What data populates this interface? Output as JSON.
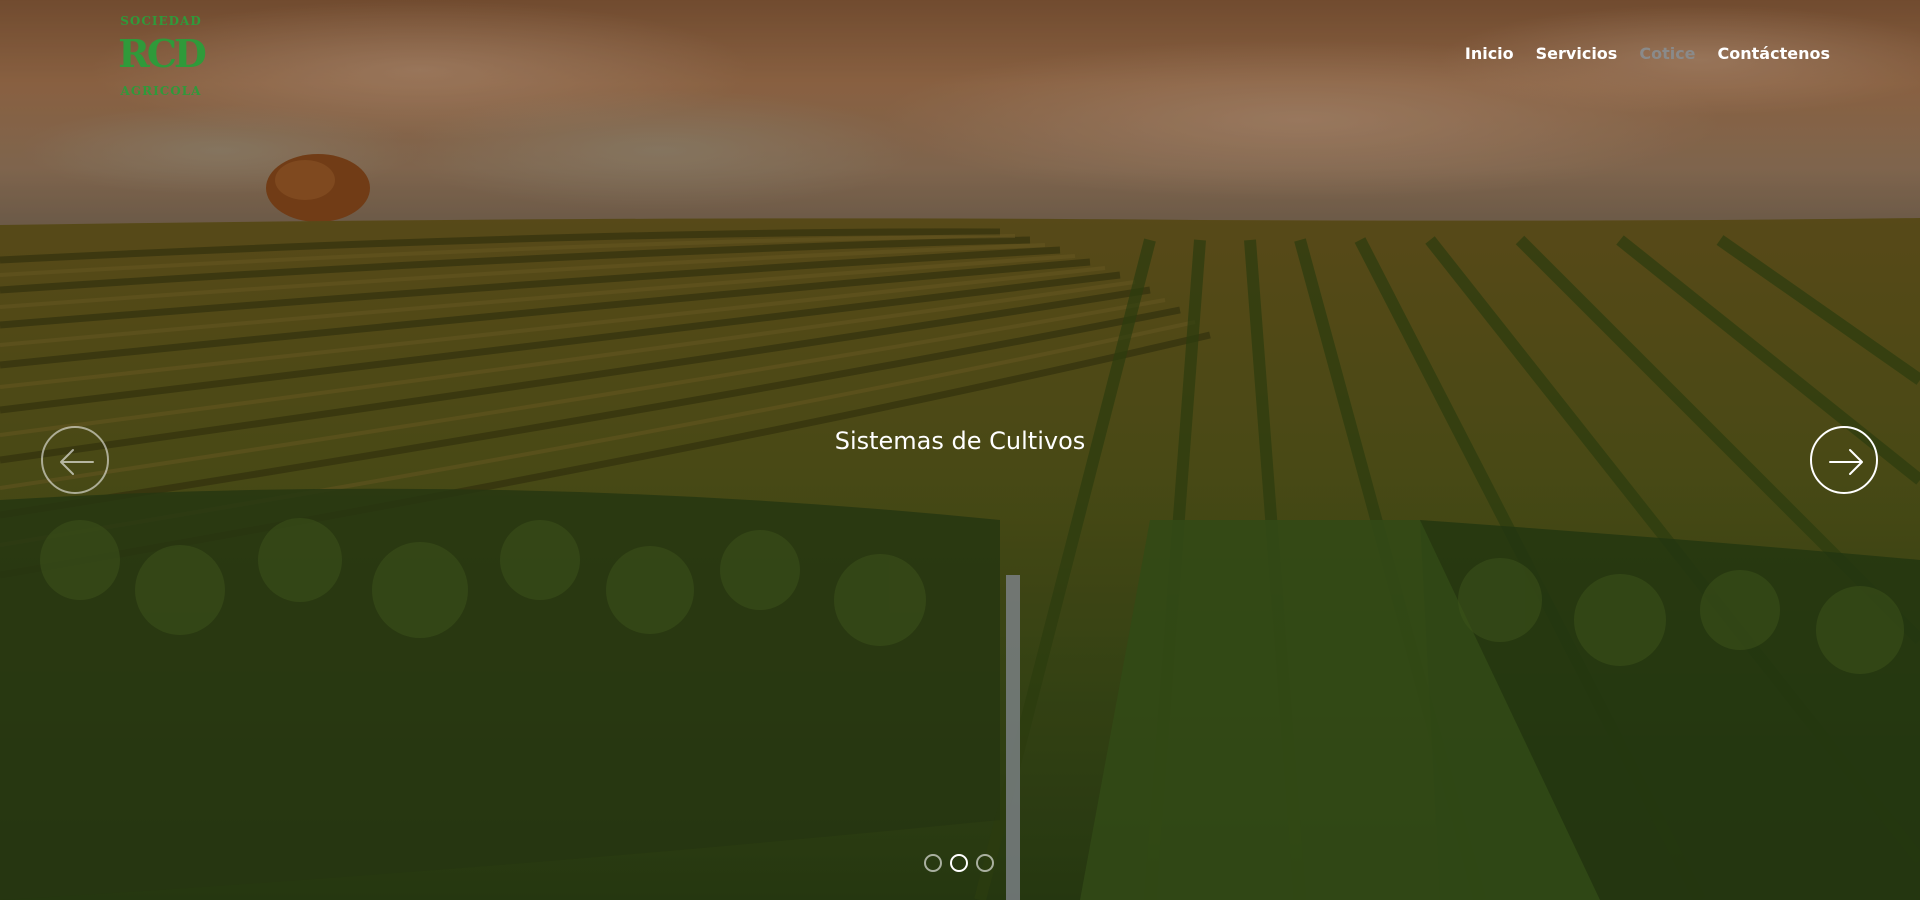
{
  "brand": {
    "logo_top": "SOCIEDAD",
    "logo_mark": "RCD",
    "logo_bottom": "AGRICOLA",
    "color": "#2f9a3a"
  },
  "nav": {
    "items": [
      {
        "label": "Inicio",
        "active": false
      },
      {
        "label": "Servicios",
        "active": false
      },
      {
        "label": "Cotice",
        "active": true
      },
      {
        "label": "Contáctenos",
        "active": false
      }
    ]
  },
  "carousel": {
    "caption": "Sistemas de Cultivos",
    "prev_icon": "arrow-left-icon",
    "next_icon": "arrow-right-icon",
    "slide_count": 3,
    "active_index": 1
  },
  "colors": {
    "sky": "#b07a4e",
    "field": "#4e5a1c",
    "nav_active": "#8a8a8a",
    "text": "#ffffff"
  }
}
